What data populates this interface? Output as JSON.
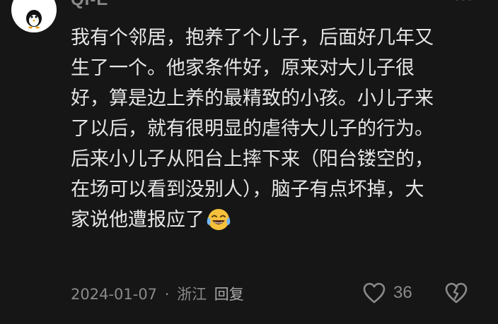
{
  "comment": {
    "username": "QI-E",
    "avatar_icon": "penguin-icon",
    "more_icon": "more-dots-icon",
    "text_lines": [
      "我有个邻居，抱养了个儿子，后面好几年又",
      "生了一个。他家条件好，原来对大儿子很",
      "好，算是边上养的最精致的小孩。小儿子来",
      "了以后，就有很明显的虐待大儿子的行为。",
      "后来小儿子从阳台上摔下来（阳台镂空的，",
      "在场可以看到没别人），脑子有点坏掉，大",
      "家说他遭报应了"
    ],
    "emoji": "crying-laughing-emoji",
    "date": "2024-01-07",
    "separator": "·",
    "location": "浙江",
    "reply_label": "回复",
    "like_icon": "heart-icon",
    "like_count": "36",
    "dislike_icon": "broken-heart-icon"
  },
  "colors": {
    "background": "#161616",
    "text": "#e6e6e6",
    "meta": "#8a8a8a",
    "emoji_face": "#f5c13c"
  }
}
